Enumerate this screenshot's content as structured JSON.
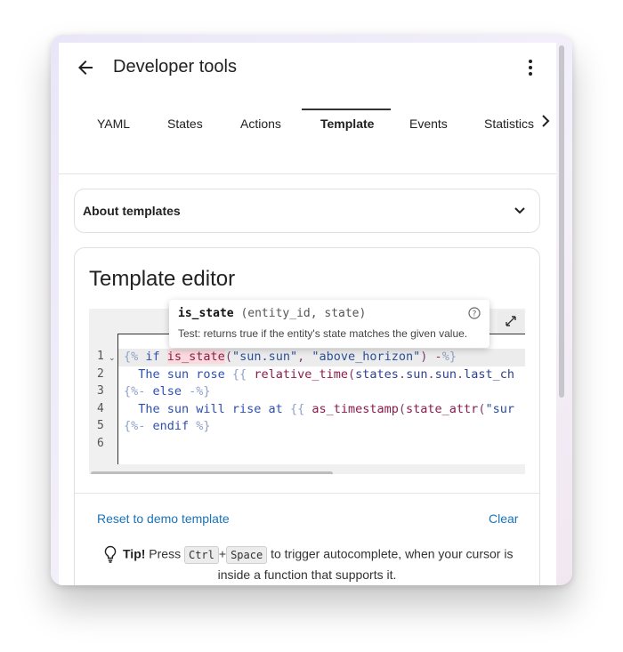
{
  "header": {
    "title": "Developer tools",
    "back_icon": "arrow-left-icon",
    "menu_icon": "more-vertical-icon"
  },
  "tabs": [
    {
      "label": "YAML",
      "active": false
    },
    {
      "label": "States",
      "active": false
    },
    {
      "label": "Actions",
      "active": false
    },
    {
      "label": "Template",
      "active": true
    },
    {
      "label": "Events",
      "active": false
    },
    {
      "label": "Statistics",
      "active": false
    }
  ],
  "about": {
    "label": "About templates",
    "expanded": false
  },
  "editor": {
    "title": "Template editor",
    "line_numbers": [
      "1",
      "2",
      "3",
      "4",
      "5",
      "6"
    ],
    "lines": [
      [
        "{%",
        " if ",
        "is_state",
        "(",
        "\"sun.sun\"",
        ", ",
        "\"above_horizon\"",
        ") -",
        "%}"
      ],
      [
        "  The sun rose ",
        "{{",
        " ",
        "relative_time",
        "(",
        "states",
        ".",
        "sun",
        ".",
        "sun",
        ".",
        "last_ch"
      ],
      [
        "{%-",
        " else ",
        "-%}"
      ],
      [
        "  The sun will rise at ",
        "{{",
        " ",
        "as_timestamp",
        "(",
        "state_attr",
        "(",
        "\"sur"
      ],
      [
        "{%-",
        " endif ",
        "%}"
      ],
      [
        ""
      ]
    ]
  },
  "tooltip": {
    "function": "is_state",
    "params": " (entity_id, state)",
    "description": "Test: returns true if the entity's state matches the given value."
  },
  "actions": {
    "reset_label": "Reset to demo template",
    "clear_label": "Clear"
  },
  "tip": {
    "strong": "Tip!",
    "press": "Press",
    "key1": "Ctrl",
    "plus": "+",
    "key2": "Space",
    "rest": "to trigger autocomplete, when your cursor is",
    "line2": "inside a function that supports it."
  },
  "colors": {
    "accent": "#1a73b8",
    "active_tab_underline": "#333333"
  }
}
